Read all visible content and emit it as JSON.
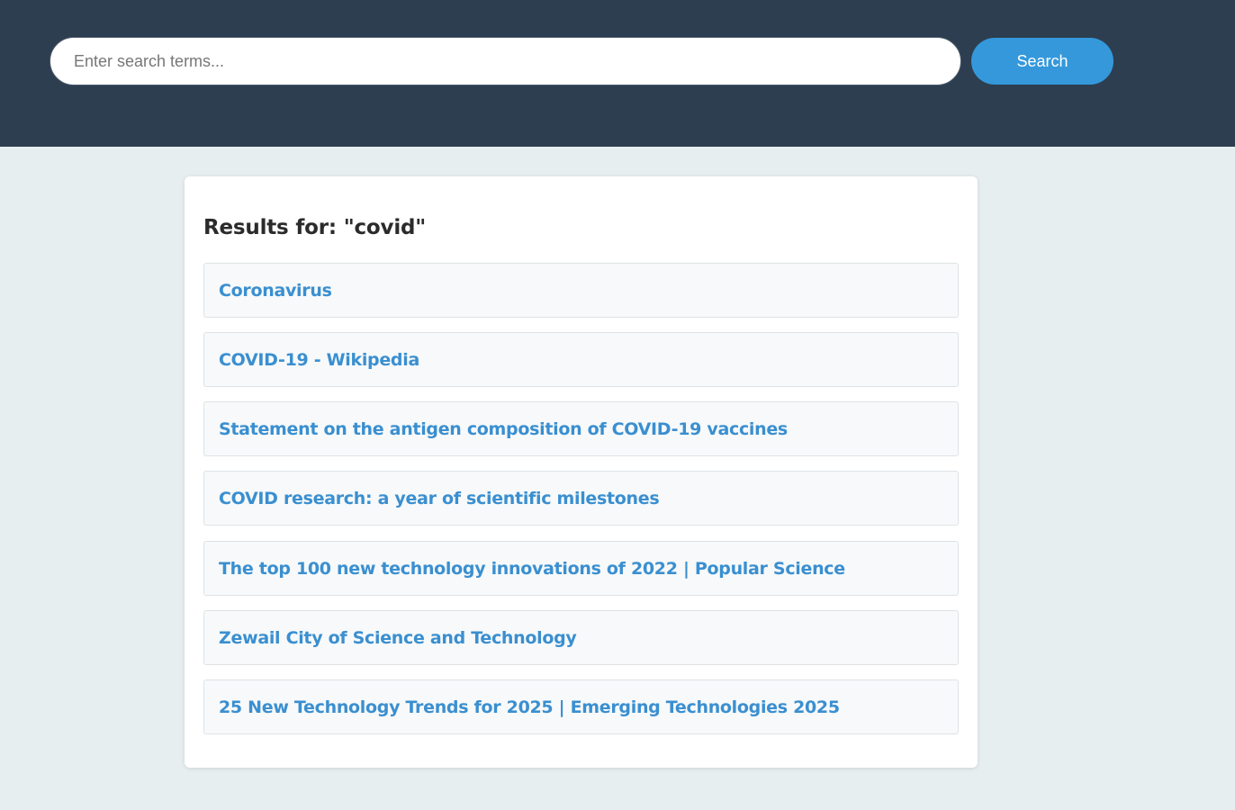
{
  "search": {
    "value": "",
    "placeholder": "Enter search terms...",
    "button_label": "Search"
  },
  "results": {
    "heading": "Results for: \"covid\"",
    "items": [
      {
        "title": "Coronavirus"
      },
      {
        "title": "COVID-19 - Wikipedia"
      },
      {
        "title": "Statement on the antigen composition of COVID-19 vaccines"
      },
      {
        "title": "COVID research: a year of scientific milestones"
      },
      {
        "title": "The top 100 new technology innovations of 2022 | Popular Science"
      },
      {
        "title": "Zewail City of Science and Technology"
      },
      {
        "title": "25 New Technology Trends for 2025 | Emerging Technologies 2025"
      }
    ]
  },
  "colors": {
    "header_bg": "#2d3e50",
    "page_bg": "#e6eef0",
    "accent": "#3498db",
    "link": "#3a8fd0"
  }
}
